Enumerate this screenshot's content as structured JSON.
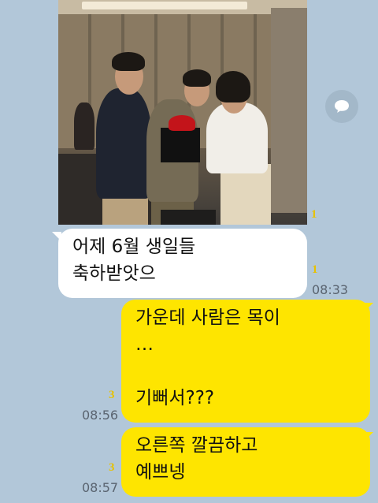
{
  "messages": [
    {
      "side": "left",
      "type": "photo",
      "unread": "1"
    },
    {
      "side": "left",
      "type": "text",
      "text": "어제 6월 생일들\n축하받앗으",
      "unread": "1",
      "time": "08:33"
    },
    {
      "side": "right",
      "type": "text",
      "text": "가운데 사람은  목이\n…\n\n기뻐서???",
      "unread": "3",
      "time": "08:56"
    },
    {
      "side": "right",
      "type": "text",
      "text": "오른쪽 깔끔하고\n예쁘넹",
      "unread": "3",
      "time": "08:57"
    }
  ],
  "icons": {
    "share": "share-chat-icon"
  },
  "colors": {
    "background": "#b2c7d9",
    "my_bubble": "#fee500",
    "their_bubble": "#ffffff",
    "unread": "#e7c200"
  }
}
